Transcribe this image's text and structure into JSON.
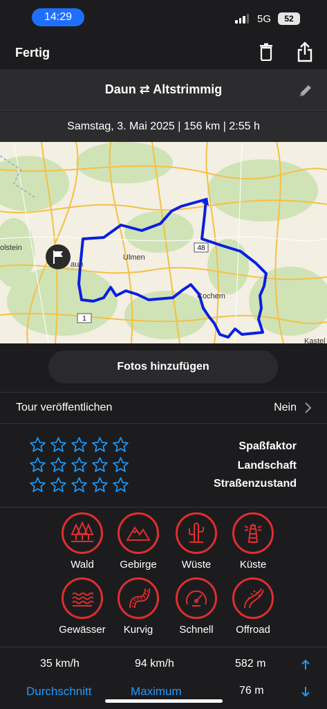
{
  "status": {
    "time": "14:29",
    "network": "5G",
    "battery": "52"
  },
  "nav": {
    "done_label": "Fertig",
    "trash_icon": "trash-icon",
    "share_icon": "share-icon"
  },
  "tour": {
    "title": "Daun ⇄ Altstrimmig",
    "info": "Samstag, 3. Mai 2025 | 156 km | 2:55 h"
  },
  "map": {
    "labels": {
      "olstein": "olstein",
      "daun": "aun",
      "ulmen": "Ulmen",
      "cochem": "Cochem",
      "kastel": "Kastel"
    },
    "road_badges": {
      "b48": "48",
      "b1": "1"
    },
    "route_color": "#0a1fe0"
  },
  "photos_button": "Fotos hinzufügen",
  "publish": {
    "label": "Tour veröffentlichen",
    "value": "Nein"
  },
  "ratings": [
    {
      "label": "Spaßfaktor",
      "stars": 0,
      "max": 5
    },
    {
      "label": "Landschaft",
      "stars": 0,
      "max": 5
    },
    {
      "label": "Straßenzustand",
      "stars": 0,
      "max": 5
    }
  ],
  "categories": [
    {
      "label": "Wald",
      "icon": "trees-icon"
    },
    {
      "label": "Gebirge",
      "icon": "mountains-icon"
    },
    {
      "label": "Wüste",
      "icon": "cactus-icon"
    },
    {
      "label": "Küste",
      "icon": "lighthouse-icon"
    },
    {
      "label": "Gewässer",
      "icon": "waves-icon"
    },
    {
      "label": "Kurvig",
      "icon": "curvy-road-icon"
    },
    {
      "label": "Schnell",
      "icon": "speedometer-icon"
    },
    {
      "label": "Offroad",
      "icon": "offroad-icon"
    }
  ],
  "stats": {
    "avg_speed": "35 km/h",
    "max_speed": "94 km/h",
    "ascent": "582 m",
    "descent": "76 m",
    "avg_label": "Durchschnitt",
    "max_label": "Maximum"
  },
  "colors": {
    "accent_red": "#e02e2e",
    "accent_blue": "#1e9bff",
    "star_blue": "#1e9bff",
    "time_pill": "#1f6fff"
  }
}
